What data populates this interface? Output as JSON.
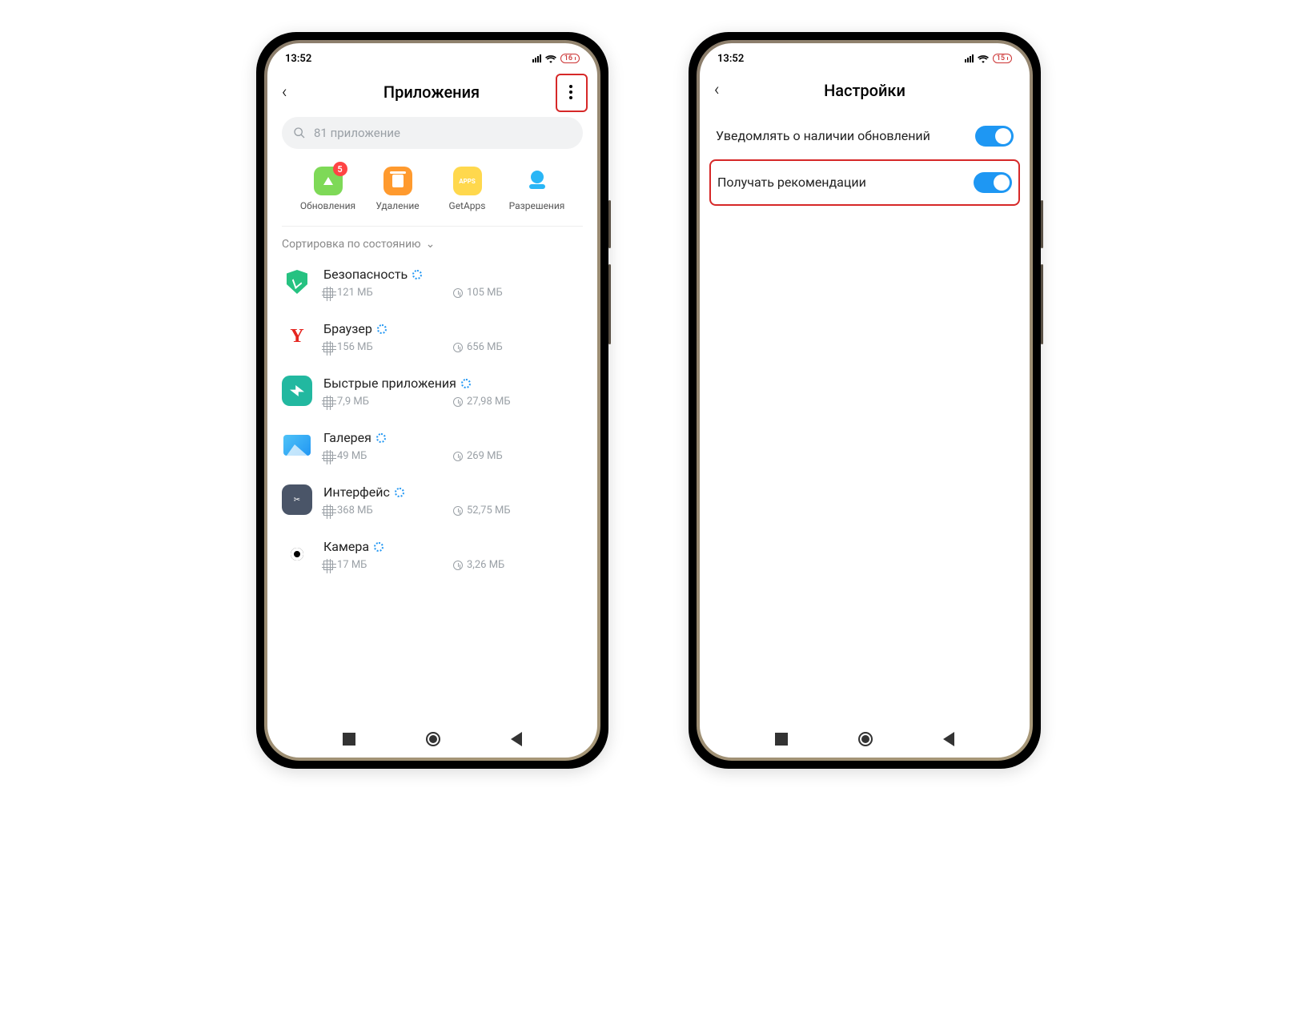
{
  "status": {
    "time": "13:52",
    "battery_left": "16",
    "battery_right": "15"
  },
  "left": {
    "title": "Приложения",
    "search_placeholder": "81 приложение",
    "chips": [
      {
        "label": "Обновления",
        "badge": "5"
      },
      {
        "label": "Удаление"
      },
      {
        "label": "GetApps"
      },
      {
        "label": "Разрешения"
      }
    ],
    "sort_label": "Сортировка по состоянию",
    "apps": [
      {
        "name": "Безопасность",
        "storage": "121 МБ",
        "time": "105 МБ"
      },
      {
        "name": "Браузер",
        "storage": "156 МБ",
        "time": "656 МБ"
      },
      {
        "name": "Быстрые приложения",
        "storage": "7,9 МБ",
        "time": "27,98 МБ"
      },
      {
        "name": "Галерея",
        "storage": "49 МБ",
        "time": "269 МБ"
      },
      {
        "name": "Интерфейс",
        "storage": "368 МБ",
        "time": "52,75 МБ"
      },
      {
        "name": "Камера",
        "storage": "17 МБ",
        "time": "3,26 МБ"
      }
    ]
  },
  "right": {
    "title": "Настройки",
    "settings": [
      {
        "label": "Уведомлять о наличии обновлений",
        "on": true
      },
      {
        "label": "Получать рекомендации",
        "on": true,
        "highlight": true
      }
    ]
  }
}
